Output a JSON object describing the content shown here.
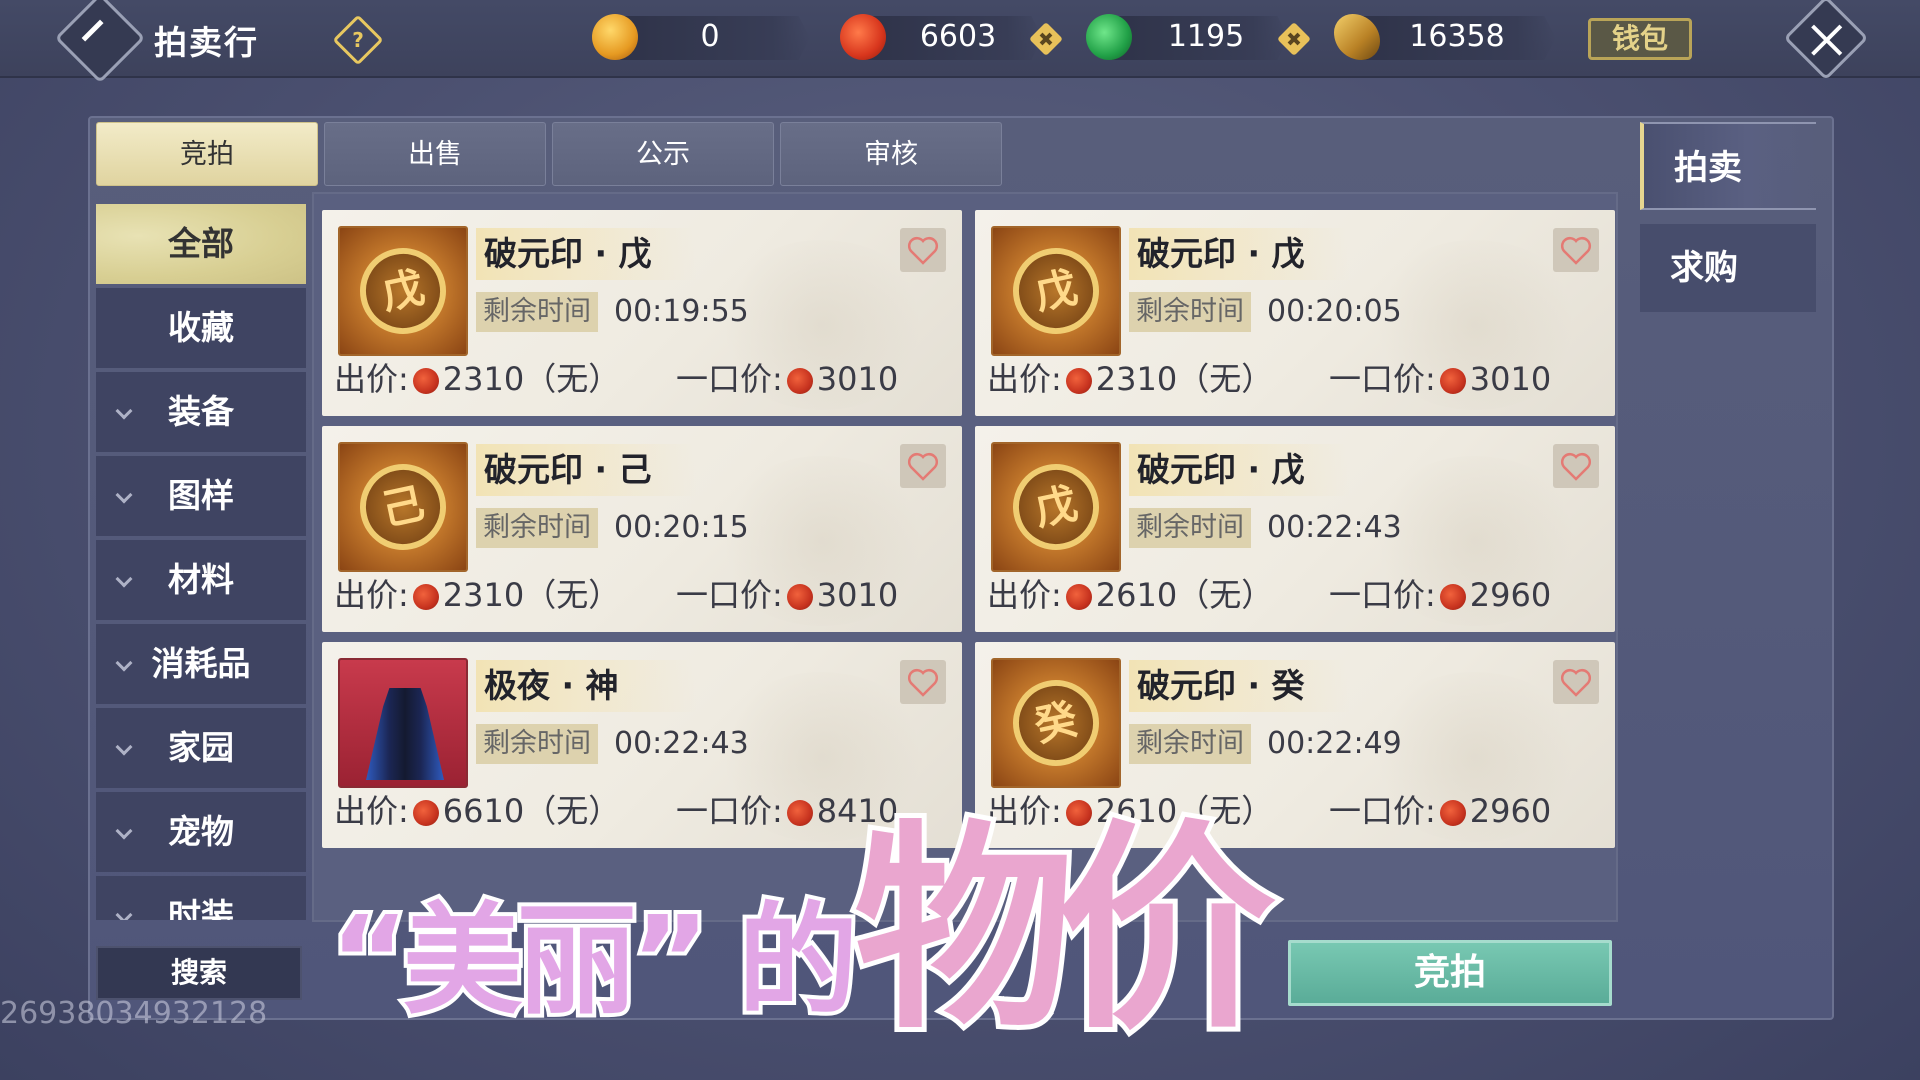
{
  "header": {
    "title": "拍卖行",
    "currencies": [
      {
        "icon": "gold-ingot-icon",
        "value": "0"
      },
      {
        "icon": "red-swirl-coin-icon",
        "value": "6603"
      },
      {
        "icon": "jade-coin-icon",
        "value": "1195"
      },
      {
        "icon": "gold-leaf-icon",
        "value": "16358"
      }
    ],
    "wallet_label": "钱包"
  },
  "tabs": [
    "竞拍",
    "出售",
    "公示",
    "审核"
  ],
  "right_tabs": [
    "拍卖",
    "求购"
  ],
  "side_nav": [
    "全部",
    "收藏",
    "装备",
    "图样",
    "材料",
    "消耗品",
    "家园",
    "宠物",
    "时装"
  ],
  "search_label": "搜索",
  "watermark_id": "26938034932128",
  "bid_button_label": "竞拍",
  "card_labels": {
    "time": "剩余时间",
    "bid": "出价:",
    "buyout": "一口价:"
  },
  "listings": [
    {
      "name": "破元印 · 戊",
      "glyph": "戊",
      "time": "00:19:55",
      "bid": "2310（无）",
      "buyout": "3010"
    },
    {
      "name": "破元印 · 戊",
      "glyph": "戊",
      "time": "00:20:05",
      "bid": "2310（无）",
      "buyout": "3010"
    },
    {
      "name": "破元印 · 己",
      "glyph": "己",
      "time": "00:20:15",
      "bid": "2310（无）",
      "buyout": "3010"
    },
    {
      "name": "破元印 · 戊",
      "glyph": "戊",
      "time": "00:22:43",
      "bid": "2610（无）",
      "buyout": "2960"
    },
    {
      "name": "极夜 · 神",
      "glyph": "",
      "time": "00:22:43",
      "bid": "6610（无）",
      "buyout": "8410"
    },
    {
      "name": "破元印 · 癸",
      "glyph": "癸",
      "time": "00:22:49",
      "bid": "2610（无）",
      "buyout": "2960"
    }
  ],
  "caption": {
    "part1": "“美丽”",
    "part2": "的",
    "part3": "物价"
  }
}
